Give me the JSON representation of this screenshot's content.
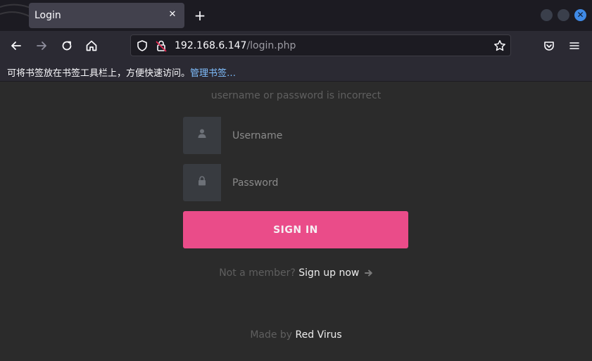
{
  "browser": {
    "tab_title": "Login",
    "tab_close": "✕",
    "new_tab": "+",
    "url_host": "192.168.6.147",
    "url_path": "/login.php",
    "bookmarks_hint": "可将书签放在书签工具栏上，方便快速访问。",
    "bookmarks_manage": "管理书签…",
    "close_glyph": "✕"
  },
  "page": {
    "error_message": "username or password is incorrect",
    "username_placeholder": "Username",
    "password_placeholder": "Password",
    "sign_in_label": "SIGN IN",
    "member_prompt": "Not a member?",
    "signup_link": "Sign up now",
    "made_by_label": "Made by",
    "made_by_name": "Red Virus"
  },
  "colors": {
    "accent": "#ea4c89",
    "background": "#2b2b2b",
    "icon_box": "#383b40",
    "window_close": "#3f8ae6"
  },
  "icons": [
    "back-icon",
    "forward-icon",
    "reload-icon",
    "home-icon",
    "shield-icon",
    "insecure-lock-icon",
    "star-icon",
    "pocket-icon",
    "menu-icon",
    "user-icon",
    "lock-icon",
    "arrow-right-icon"
  ]
}
